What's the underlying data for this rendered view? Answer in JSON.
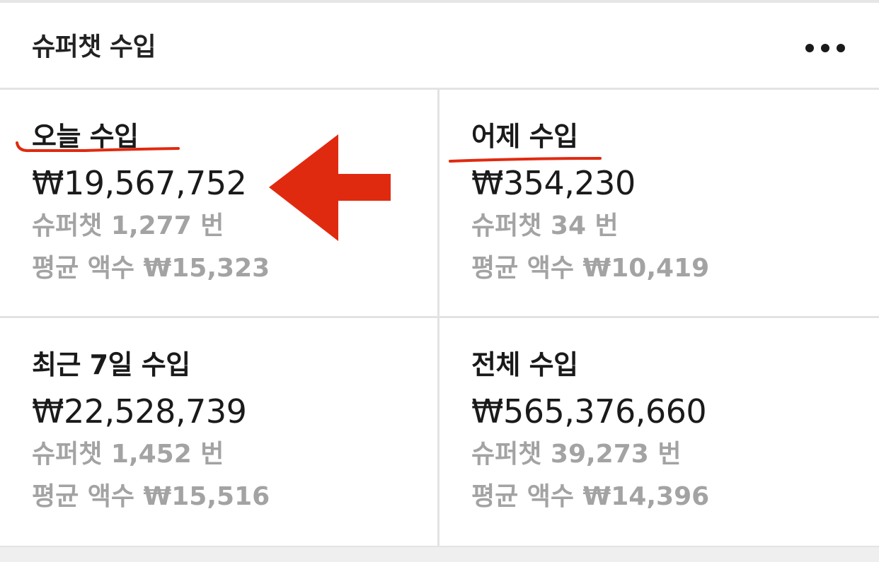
{
  "header": {
    "title": "슈퍼챗 수입",
    "more_icon": "more-horizontal-icon"
  },
  "cards": [
    {
      "label": "오늘 수입",
      "amount": "₩19,567,752",
      "count": "슈퍼챗 1,277 번",
      "avg": "평균 액수 ₩15,323"
    },
    {
      "label": "어제 수입",
      "amount": "₩354,230",
      "count": "슈퍼챗 34 번",
      "avg": "평균 액수 ₩10,419"
    },
    {
      "label": "최근 7일 수입",
      "amount": "₩22,528,739",
      "count": "슈퍼챗 1,452 번",
      "avg": "평균 액수 ₩15,516"
    },
    {
      "label": "전체 수입",
      "amount": "₩565,376,660",
      "count": "슈퍼챗 39,273 번",
      "avg": "평균 액수 ₩14,396"
    }
  ],
  "annotations": {
    "color": "#e02a10",
    "arrow_icon": "left-arrow-icon"
  }
}
